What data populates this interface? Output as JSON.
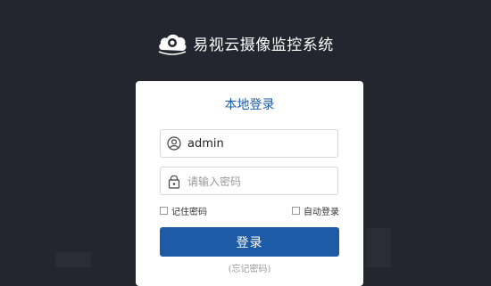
{
  "app": {
    "title": "易视云摄像监控系统",
    "logo_icon": "cloud-camera-icon"
  },
  "login": {
    "tab_title": "本地登录",
    "username": {
      "value": "admin",
      "icon": "user-icon"
    },
    "password": {
      "placeholder": "请输入密码",
      "icon": "lock-icon"
    },
    "remember_label": "记住密码",
    "auto_login_label": "自动登录",
    "submit_label": "登录",
    "bottom_link": "(忘记密码)"
  },
  "colors": {
    "background": "#23262f",
    "accent": "#1e5ba6",
    "card": "#ffffff"
  }
}
